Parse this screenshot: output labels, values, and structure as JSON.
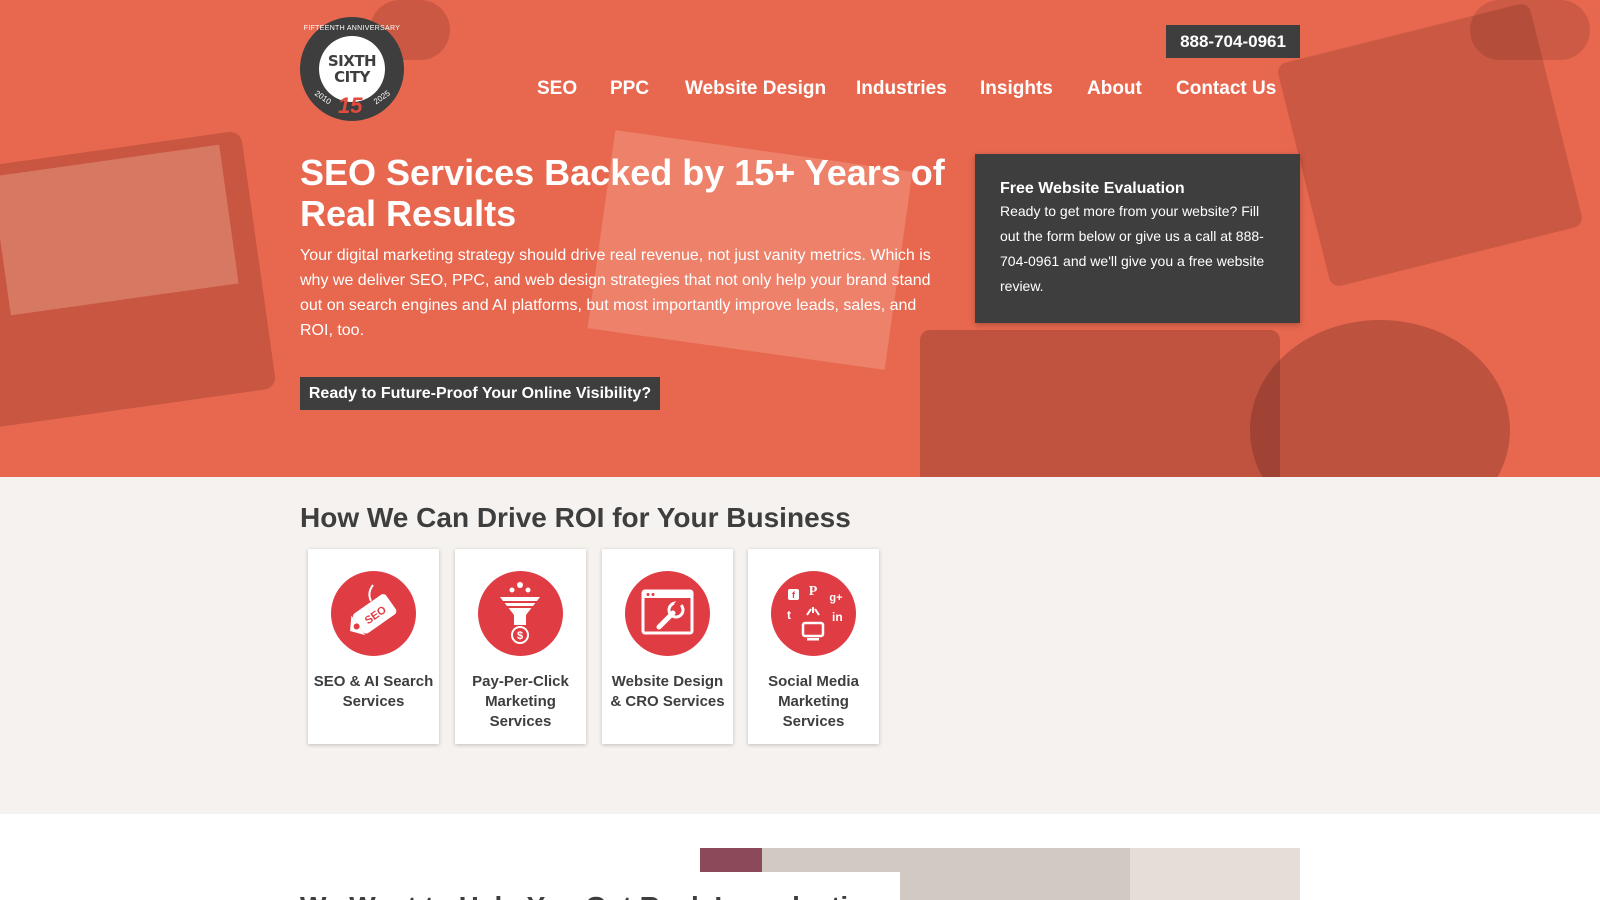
{
  "logo": {
    "ring_text": "FIFTEENTH ANNIVERSARY",
    "word_top": "SIXTH",
    "word_bottom": "CITY",
    "year_start": "2010",
    "year_end": "2025",
    "number": "15"
  },
  "header": {
    "phone": "888-704-0961",
    "nav": [
      "SEO",
      "PPC",
      "Website Design",
      "Industries",
      "Insights",
      "About",
      "Contact Us"
    ]
  },
  "hero": {
    "title": "SEO Services Backed by 15+ Years of Real Results",
    "body": "Your digital marketing strategy should drive real revenue, not just vanity metrics. Which is why we deliver SEO, PPC, and web design strategies that not only help your brand stand out on search engines and AI platforms, but most importantly improve leads, sales, and ROI, too.",
    "cta": "Ready to Future-Proof Your Online Visibility?"
  },
  "evaluation": {
    "title": "Free Website Evaluation",
    "text": "Ready to get more from your website? Fill out the form below or give us a call at 888-704-0961 and we'll give you a free website review."
  },
  "services": {
    "title": "How We Can Drive ROI for Your Business",
    "cards": [
      {
        "label": "SEO & AI Search Services",
        "icon": "seo-tag-icon"
      },
      {
        "label": "Pay-Per-Click Marketing Services",
        "icon": "funnel-dollar-icon"
      },
      {
        "label": "Website Design & CRO Services",
        "icon": "browser-wrench-icon"
      },
      {
        "label": "Social Media Marketing Services",
        "icon": "social-network-icon"
      }
    ]
  },
  "bottom": {
    "title": "We Want to Help You Get Real, Long-lasting"
  },
  "colors": {
    "hero_overlay": "#e8684f",
    "dark": "#3e3e3e",
    "accent_red": "#e03c44",
    "section_bg": "#f6f2ef"
  }
}
